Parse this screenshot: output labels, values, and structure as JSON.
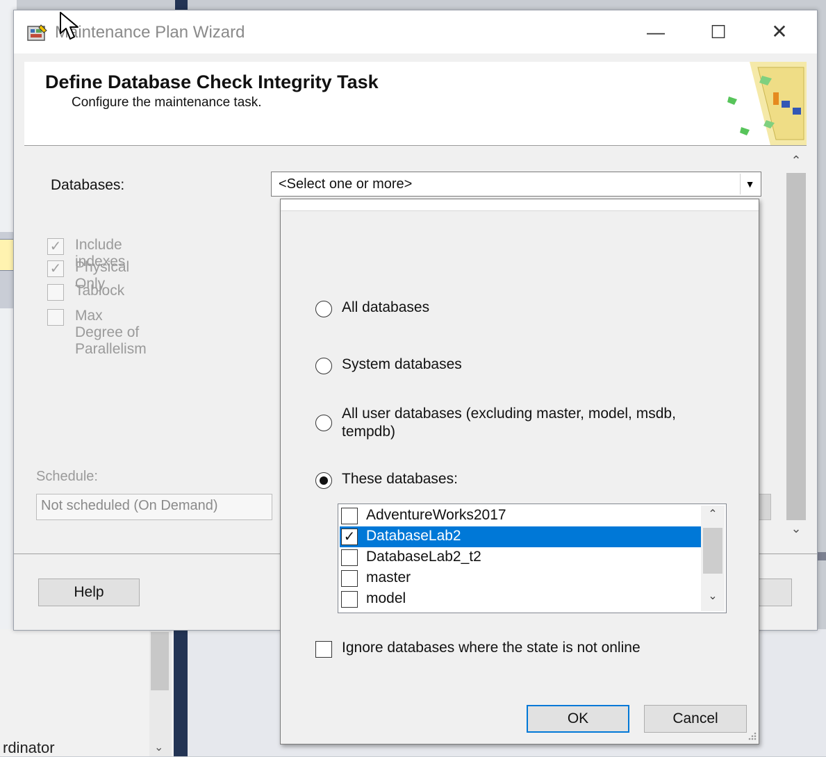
{
  "window": {
    "title": "Maintenance Plan Wizard",
    "minimize_glyph": "—",
    "maximize_glyph": "☐",
    "close_glyph": "✕"
  },
  "header": {
    "title": "Define Database Check Integrity Task",
    "subtitle": "Configure the maintenance task."
  },
  "form": {
    "databases_label": "Databases:",
    "databases_value": "<Select one or more>",
    "options": [
      {
        "label": "Include indexes",
        "checked": true
      },
      {
        "label": "Physical Only",
        "checked": true
      },
      {
        "label": "Tablock",
        "checked": false
      },
      {
        "label": "Max Degree of Parallelism",
        "checked": false
      }
    ],
    "schedule_label": "Schedule:",
    "schedule_value": "Not scheduled (On Demand)"
  },
  "buttons": {
    "help": "Help"
  },
  "popup": {
    "radios": [
      {
        "label": "All databases",
        "selected": false
      },
      {
        "label": "System databases",
        "selected": false
      },
      {
        "label": "All user databases  (excluding master, model, msdb, tempdb)",
        "selected": false
      },
      {
        "label": "These databases:",
        "selected": true
      }
    ],
    "databases": [
      {
        "name": "AdventureWorks2017",
        "checked": false,
        "selected": false
      },
      {
        "name": "DatabaseLab2",
        "checked": true,
        "selected": true
      },
      {
        "name": "DatabaseLab2_t2",
        "checked": false,
        "selected": false
      },
      {
        "name": "master",
        "checked": false,
        "selected": false
      },
      {
        "name": "model",
        "checked": false,
        "selected": false
      }
    ],
    "ignore_label": "Ignore databases where the state is not online",
    "ignore_checked": false,
    "ok": "OK",
    "cancel": "Cancel"
  },
  "background": {
    "partial_text": "rdinator"
  },
  "colors": {
    "selection": "#0078d7",
    "window_bg": "#f0f0f0"
  }
}
